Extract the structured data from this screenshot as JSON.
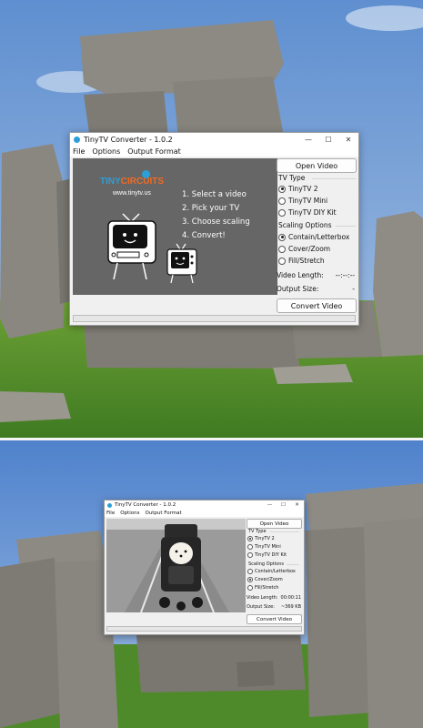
{
  "window": {
    "title": "TinyTV Converter - 1.0.2",
    "controls": {
      "minimize": "—",
      "maximize": "☐",
      "close": "✕"
    }
  },
  "menu": [
    "File",
    "Options",
    "Output Format"
  ],
  "preview": {
    "logo_tiny": "TINY",
    "logo_circuits": "CIRCUITS",
    "logo_url": "www.tinytv.us",
    "steps": [
      "1. Select a video",
      "2. Pick your TV",
      "3. Choose scaling",
      "4. Convert!"
    ]
  },
  "buttons": {
    "open_video": "Open Video",
    "convert_video": "Convert Video"
  },
  "tv_type": {
    "title": "TV Type",
    "options": [
      "TinyTV 2",
      "TinyTV Mini",
      "TinyTV DIY Kit"
    ]
  },
  "scaling": {
    "title": "Scaling Options",
    "options": [
      "Contain/Letterbox",
      "Cover/Zoom",
      "Fill/Stretch"
    ]
  },
  "labels": {
    "video_length": "Video Length:",
    "output_size": "Output Size:"
  },
  "state_before": {
    "tv_selected": "TinyTV 2",
    "scaling_selected": "Contain/Letterbox",
    "video_length": "--:--:--",
    "output_size": "-",
    "progress": 0
  },
  "state_after": {
    "tv_selected": "TinyTV 2",
    "scaling_selected": "Cover/Zoom",
    "video_length": "00:00:11",
    "output_size": "~369 KB",
    "progress": 0
  },
  "colors": {
    "sky": "#7fa6d6",
    "grass": "#4f8a2a",
    "stone": "#8a8780",
    "accent_blue": "#2d9fd8",
    "accent_orange": "#f26a22",
    "preview_gray": "#666666"
  }
}
